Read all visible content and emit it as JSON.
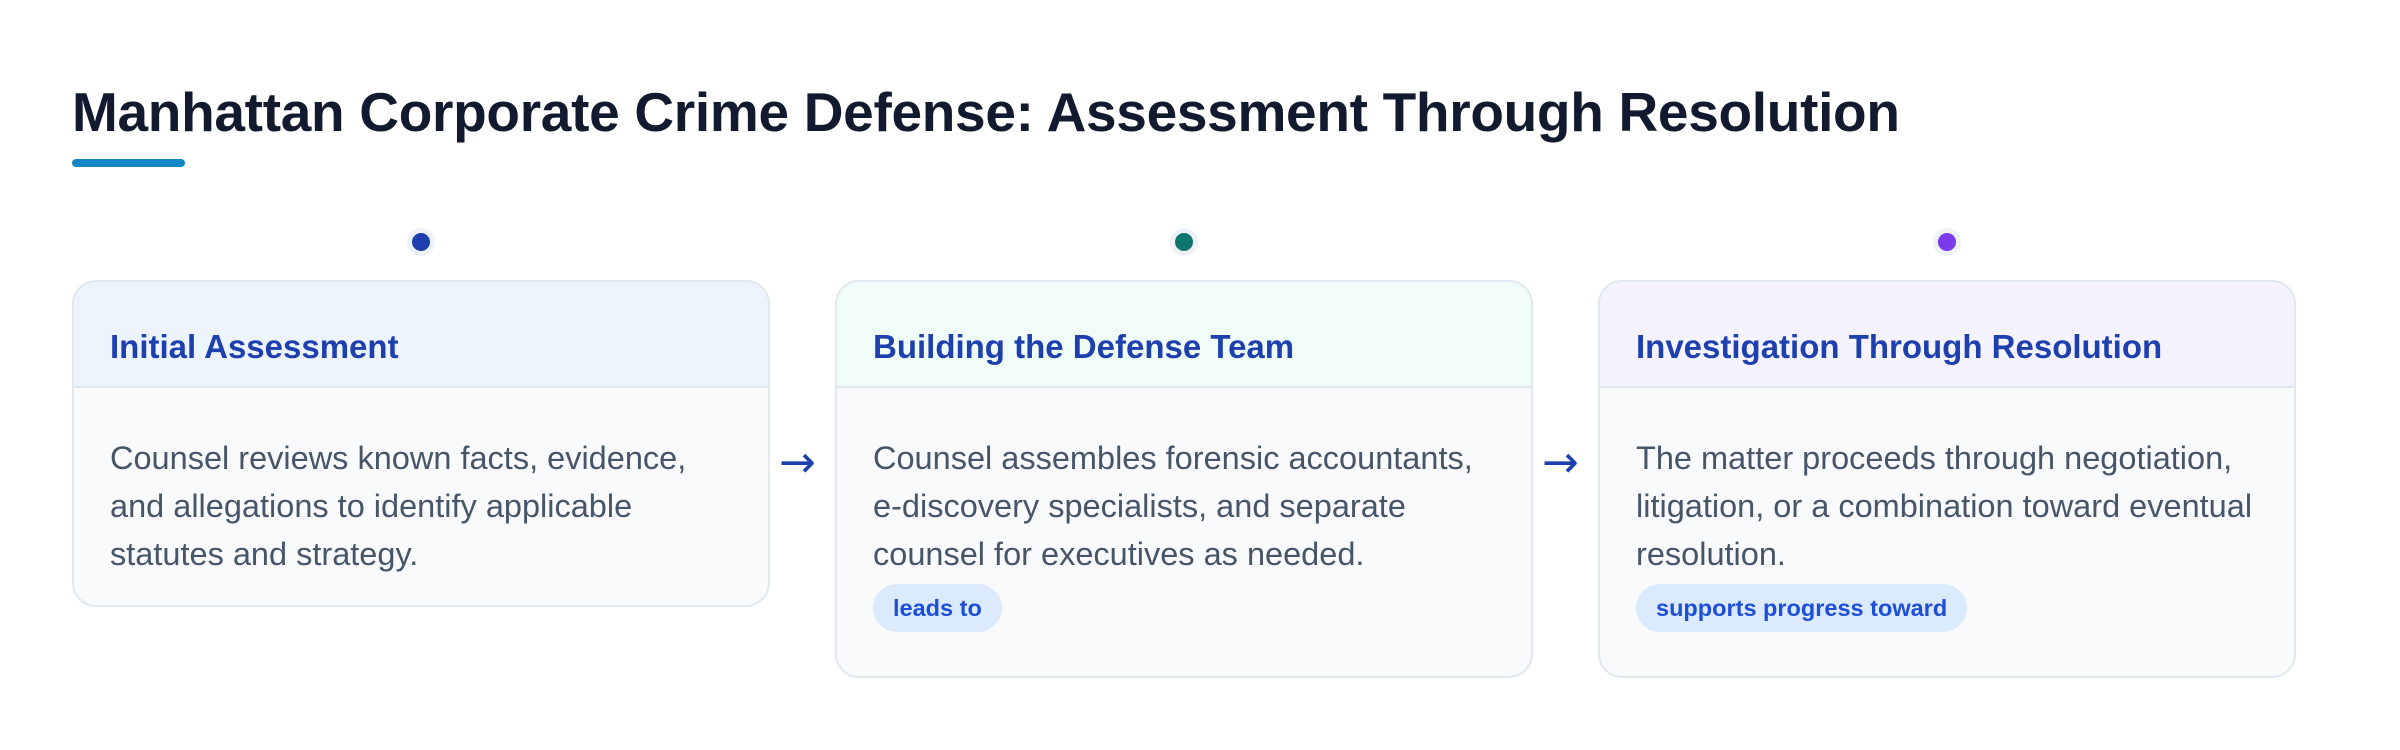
{
  "title": "Manhattan Corporate Crime Defense: Assessment Through Resolution",
  "colors": {
    "title": "#111a2e",
    "accent_underline": "#1386c6",
    "card_title": "#1e40af",
    "body_text": "#475569",
    "badge_bg": "#dbeafe",
    "badge_text": "#1d4ed8"
  },
  "stages": [
    {
      "title": "Initial Assessment",
      "body": "Counsel reviews known facts, evidence, and allegations to identify applicable statutes and strategy.",
      "dot_color": "#1e40af",
      "header_bg": "#eef4fe",
      "badge": ""
    },
    {
      "title": "Building the Defense Team",
      "body": "Counsel assembles forensic accountants, e-discovery specialists, and separate counsel for executives as needed.",
      "dot_color": "#0f766e",
      "header_bg": "#effcf8",
      "badge": "leads to"
    },
    {
      "title": "Investigation Through Resolution",
      "body": "The matter proceeds through negotiation, litigation, or a combination toward eventual resolution.",
      "dot_color": "#7c3aed",
      "header_bg": "#f5f3ff",
      "badge": "supports progress toward"
    }
  ],
  "connectors": [
    {
      "glyph": "→",
      "icon": "arrow-right-icon"
    },
    {
      "glyph": "→",
      "icon": "arrow-right-icon"
    }
  ]
}
